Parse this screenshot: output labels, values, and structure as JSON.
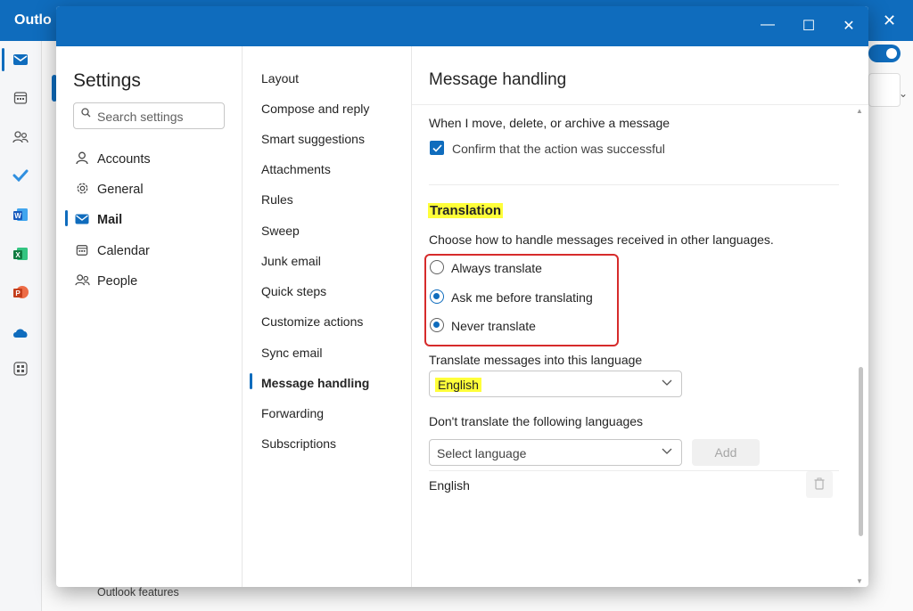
{
  "app": {
    "title": "Outlo",
    "close_glyph": "✕",
    "footer_link": "Outlook features"
  },
  "rail": {
    "icons": [
      "mail-icon",
      "calendar-icon",
      "people-icon",
      "todo-icon",
      "word-icon",
      "excel-icon",
      "powerpoint-icon",
      "onedrive-icon",
      "apps-icon"
    ]
  },
  "dialog": {
    "window_buttons": {
      "minimize": "—",
      "maximize": "☐",
      "close": "✕"
    },
    "settings_title": "Settings",
    "search_placeholder": "Search settings",
    "categories": [
      {
        "label": "Accounts",
        "icon": "person-icon"
      },
      {
        "label": "General",
        "icon": "gear-icon"
      },
      {
        "label": "Mail",
        "icon": "mail-icon",
        "selected": true
      },
      {
        "label": "Calendar",
        "icon": "calendar-icon"
      },
      {
        "label": "People",
        "icon": "people-icon"
      }
    ],
    "subcategories": [
      "Layout",
      "Compose and reply",
      "Smart suggestions",
      "Attachments",
      "Rules",
      "Sweep",
      "Junk email",
      "Quick steps",
      "Customize actions",
      "Sync email",
      "Message handling",
      "Forwarding",
      "Subscriptions"
    ],
    "selected_subcategory": "Message handling"
  },
  "content": {
    "title": "Message handling",
    "move_heading": "When I move, delete, or archive a message",
    "confirm_checkbox": {
      "label": "Confirm that the action was successful",
      "checked": true
    },
    "translation_heading": "Translation",
    "translation_prompt": "Choose how to handle messages received in other languages.",
    "translation_options": [
      {
        "label": "Always translate",
        "selected": false
      },
      {
        "label": "Ask me before translating",
        "selected": true
      },
      {
        "label": "Never translate",
        "selected": false
      }
    ],
    "translate_into_label": "Translate messages into this language",
    "translate_into_value": "English",
    "dont_translate_label": "Don't translate the following languages",
    "select_language_placeholder": "Select language",
    "add_button": "Add",
    "excluded_languages": [
      "English"
    ]
  },
  "colors": {
    "accent": "#0f6cbd",
    "highlight": "#ffff3a",
    "annotation_red": "#d62b2b"
  }
}
